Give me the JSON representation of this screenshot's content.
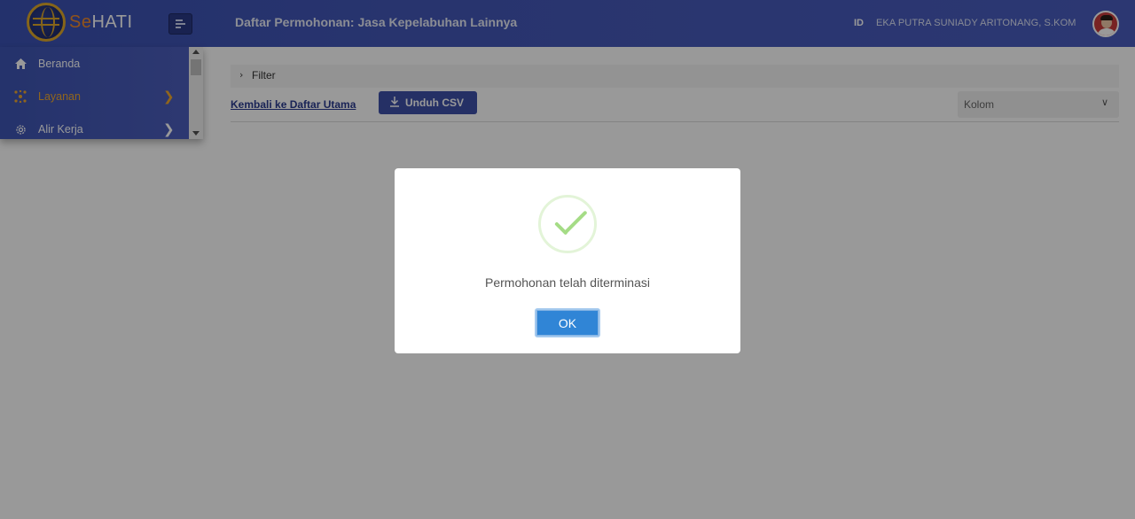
{
  "header": {
    "logo_prefix": "Se",
    "logo_suffix": "HATI",
    "menu_toggle_icon": "menu-list-icon",
    "page_title": "Daftar Permohonan: Jasa Kepelabuhan Lainnya",
    "language": "ID",
    "username": "EKA PUTRA SUNIADY ARITONANG, S.KOM"
  },
  "sidebar": {
    "items": [
      {
        "label": "Beranda",
        "icon": "home-icon",
        "color": "#ffffff",
        "has_chevron": false
      },
      {
        "label": "Layanan",
        "icon": "cluster-icon",
        "color": "#f0a830",
        "has_chevron": true
      },
      {
        "label": "Alir Kerja",
        "icon": "gear-icon",
        "color": "#ffffff",
        "has_chevron": true
      }
    ]
  },
  "main": {
    "filter_label": "Filter",
    "back_link": "Kembali ke Daftar Utama",
    "csv_button": "Unduh CSV",
    "column_select": "Kolom"
  },
  "modal": {
    "icon": "success-check-icon",
    "message": "Permohonan telah diterminasi",
    "ok_label": "OK"
  },
  "colors": {
    "header_bg": "#4458b8",
    "accent_orange": "#f28a2c",
    "ok_button": "#3085d6",
    "success_green": "#a5dc86"
  }
}
